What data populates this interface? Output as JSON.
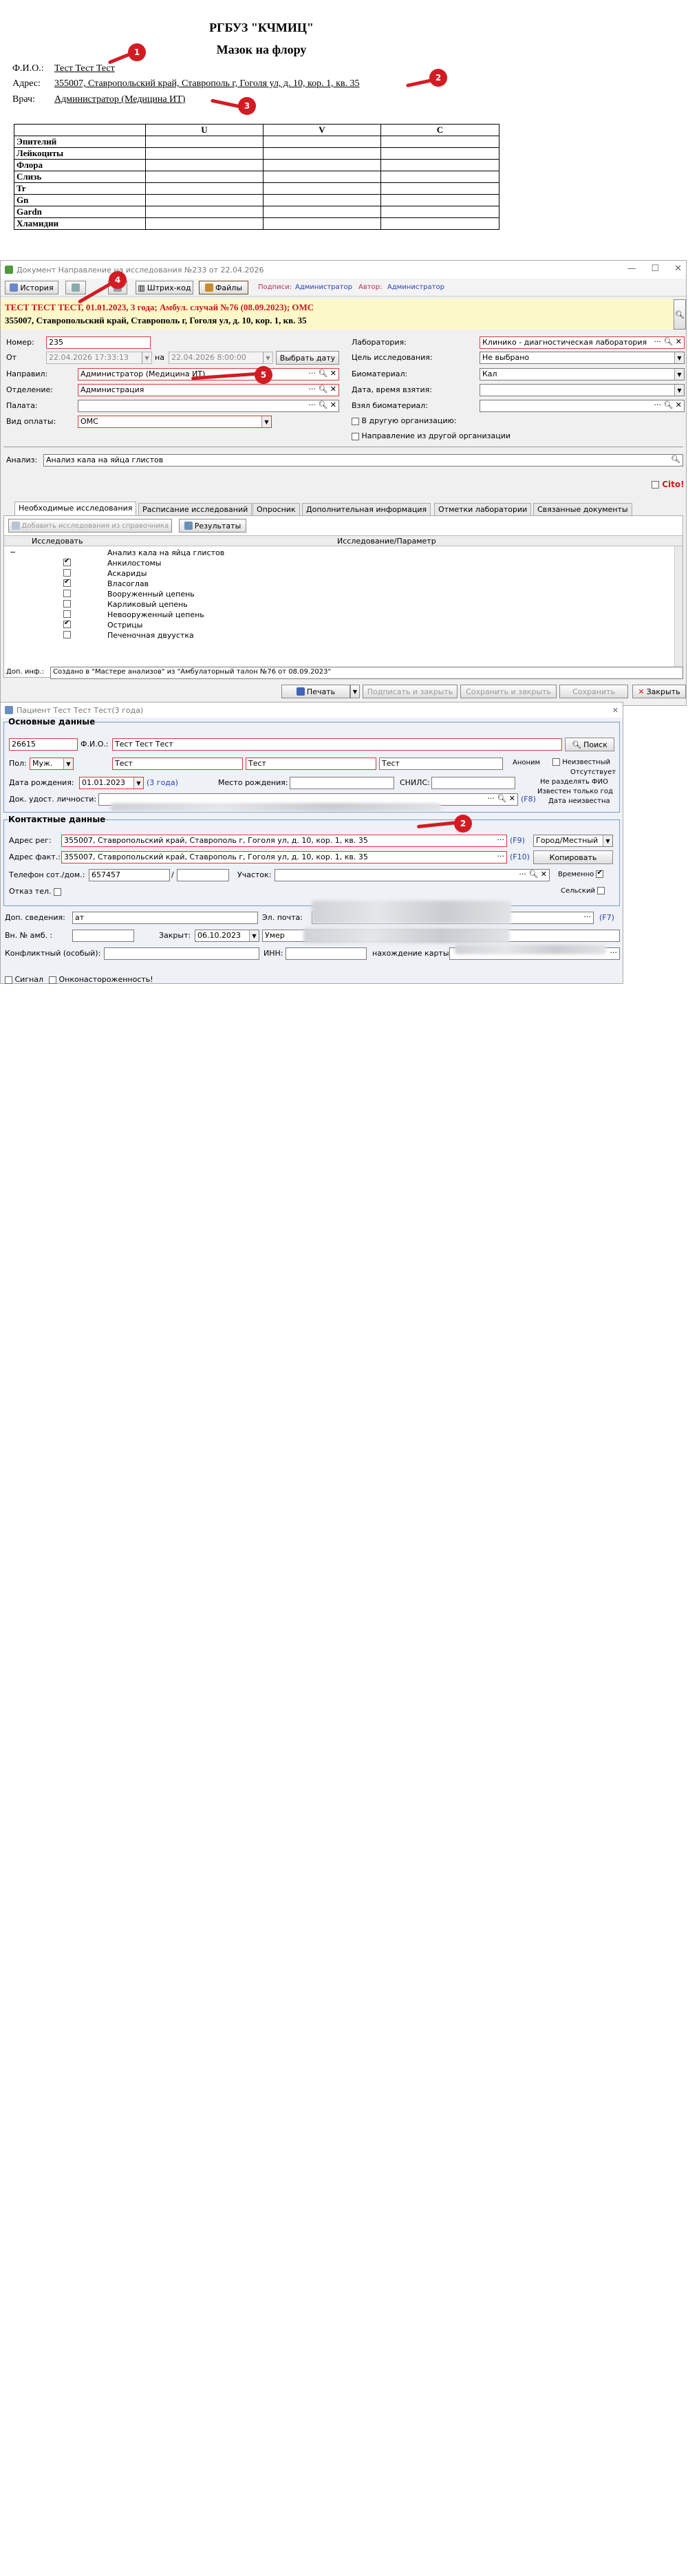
{
  "doc": {
    "org": "РГБУЗ \"КЧМИЦ\"",
    "title": "Мазок на флору",
    "fio_label": "Ф.И.О.:",
    "fio_value": "Тест Тест Тест",
    "addr_label": "Адрес:",
    "addr_value": "355007, Ставропольский край, Ставрополь г, Гоголя ул, д. 10, кор. 1, кв. 35",
    "doctor_label": "Врач:",
    "doctor_value": "Администратор (Медицина ИТ)",
    "table_headers": [
      "",
      "U",
      "V",
      "C"
    ],
    "table_rows": [
      "Эпителий",
      "Лейкоциты",
      "Флора",
      "Слизь",
      "Tr",
      "Gn",
      "Gardn",
      "Хламидии"
    ]
  },
  "markers": [
    "1",
    "2",
    "3",
    "4",
    "5"
  ],
  "w1": {
    "title": "Документ Направление на исследования №233 от 22.04.2026",
    "toolbar": {
      "history": "История",
      "barcode": "Штрих-код",
      "files": "Файлы",
      "signatures_label": "Подписи:",
      "signatures_value": "Администратор",
      "author_label": "Автор:",
      "author_value": "Администратор"
    },
    "banner1": "ТЕСТ ТЕСТ ТЕСТ, 01.01.2023, 3 года; Амбул. случай №76 (08.09.2023); ОМС",
    "banner2": "355007, Ставропольский край, Ставрополь г, Гоголя ул, д. 10, кор. 1, кв. 35",
    "number_label": "Номер:",
    "number_value": "235",
    "from_label": "От",
    "from_value": "22.04.2026 17:33:13",
    "on_label": "на",
    "on_value": "22.04.2026 8:00:00",
    "pick_date": "Выбрать дату",
    "sender_label": "Направил:",
    "sender_value": "Администратор (Медицина ИТ)",
    "dept_label": "Отделение:",
    "dept_value": "Администрация",
    "ward_label": "Палата:",
    "ward_value": "",
    "pay_label": "Вид оплаты:",
    "pay_value": "ОМС",
    "lab_label": "Лаборатория:",
    "lab_value": "Клинико - диагностическая лаборатория",
    "goal_label": "Цель исследования:",
    "goal_value": "Не выбрано",
    "bio_label": "Биоматериал:",
    "bio_value": "Кал",
    "time_label": "Дата, время взятия:",
    "time_value": "",
    "took_label": "Взял биоматериал:",
    "took_value": "",
    "other_org": "В другую организацию:",
    "from_other": "Направление из другой организации",
    "analysis_label": "Анализ:",
    "analysis_value": "Анализ кала на яйца глистов",
    "cito": "Cito!",
    "tabs": [
      "Необходимые исследования",
      "Расписание исследований",
      "Опросник",
      "Дополнительная информация",
      "Отметки лаборатории",
      "Связанные документы"
    ],
    "add_btn": "Добавить исследования из справочника",
    "results_btn": "Результаты",
    "col1": "Исследовать",
    "col2": "Исследование/Параметр",
    "rows": [
      {
        "name": "Анализ кала на яйца глистов",
        "checked": null
      },
      {
        "name": "Анкилостомы",
        "checked": true
      },
      {
        "name": "Аскариды",
        "checked": false
      },
      {
        "name": "Власоглав",
        "checked": true
      },
      {
        "name": "Вооруженный цепень",
        "checked": false
      },
      {
        "name": "Карликовый цепень",
        "checked": false
      },
      {
        "name": "Невооруженный цепень",
        "checked": false
      },
      {
        "name": "Острицы",
        "checked": true
      },
      {
        "name": "Печеночная двуустка",
        "checked": false
      }
    ],
    "dopinfo_label": "Доп. инф.:",
    "dopinfo_value": "Создано в \"Мастере анализов\" из \"Амбулаторный талон №76 от 08.09.2023\"",
    "print": "Печать",
    "print_close": "Подписать и закрыть",
    "save_close": "Сохранить и закрыть",
    "save": "Сохранить",
    "close": "Закрыть"
  },
  "w2": {
    "title": "Пациент Тест Тест Тест(3 года)",
    "main_group": "Основные данные",
    "id_value": "26615",
    "fio_label": "Ф.И.О.:",
    "fio_value": "Тест Тест Тест",
    "search_btn": "Поиск",
    "sex_label": "Пол:",
    "sex_value": "Муж.",
    "f1": "Тест",
    "f2": "Тест",
    "f3": "Тест",
    "anonym": "Аноним",
    "unknown": "Неизвестный",
    "absent": "Отсутствует",
    "birth_label": "Дата рождения:",
    "birth_value": "01.01.2023",
    "age": "(3 года)",
    "birthplace_label": "Место рождения:",
    "snils_label": "СНИЛС:",
    "not_split": "Не разделять ФИО",
    "known_year": "Известен только год",
    "date_unknown": "Дата неизвестна",
    "id_doc_label": "Док. удост. личности:",
    "f8": "(F8)",
    "contact_group": "Контактные данные",
    "reg_label": "Адрес рег:",
    "reg_value": "355007, Ставропольский край, Ставрополь г, Гоголя ул, д. 10, кор. 1, кв. 35",
    "f9": "(F9)",
    "city": "Город/Местный",
    "fact_label": "Адрес факт.:",
    "fact_value": "355007, Ставропольский край, Ставрополь г, Гоголя ул, д. 10, кор. 1, кв. 35",
    "f10": "(F10)",
    "copy": "Копировать",
    "phone_label": "Телефон сот./дом.:",
    "phone_value": "657457",
    "slash": "/",
    "area_label": "Участок:",
    "temp": "Временно",
    "refuse_label": "Отказ тел.",
    "rural": "Сельский",
    "extra_label": "Доп. сведения:",
    "extra_value": "ат",
    "email_label": "Эл. почта:",
    "f7": "(F7)",
    "amb_label": "Вн. № амб. :",
    "closed_label": "Закрыт:",
    "closed_value": "06.10.2023",
    "died": "Умер",
    "conflict_label": "Конфликтный (особый):",
    "inn_label": "ИНН:",
    "card_label": "нахождение карты:",
    "signal": "Сигнал",
    "onco": "Онконастороженность!"
  }
}
